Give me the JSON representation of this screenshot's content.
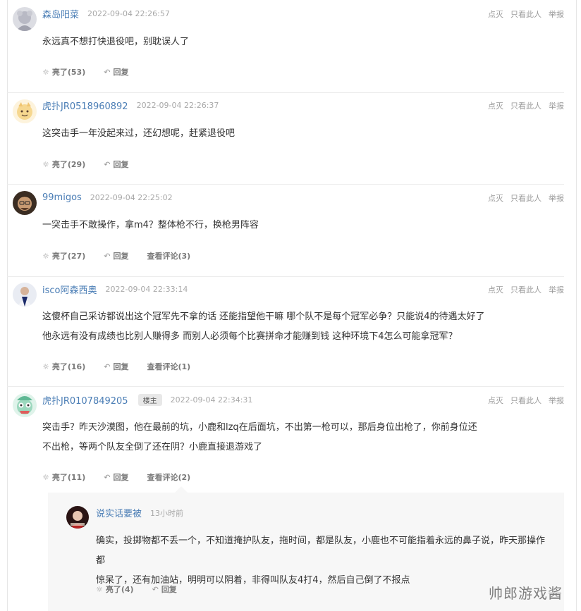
{
  "tools": {
    "dislike": "点灭",
    "only_this": "只看此人",
    "report": "举报"
  },
  "comments": [
    {
      "user": "森岛阳菜",
      "time": "2022-09-04 22:26:57",
      "lines": [
        "永远真不想打快退役吧，别耽误人了"
      ],
      "like": "亮了(53)",
      "reply": "回复",
      "view": ""
    },
    {
      "user": "虎扑JR0518960892",
      "time": "2022-09-04 22:26:37",
      "lines": [
        "这突击手一年没起来过，还幻想呢，赶紧退役吧"
      ],
      "like": "亮了(29)",
      "reply": "回复",
      "view": ""
    },
    {
      "user": "99migos",
      "time": "2022-09-04 22:25:02",
      "lines": [
        "一突击手不敢操作，拿m4？整体枪不行，换枪男阵容"
      ],
      "like": "亮了(27)",
      "reply": "回复",
      "view": "查看评论(3)"
    },
    {
      "user": "isco阿森西奥",
      "time": "2022-09-04 22:33:14",
      "lines": [
        "这傻杯自己采访都说出这个冠军先不拿的话 还能指望他干嘛 哪个队不是每个冠军必争？只能说4的待遇太好了",
        "他永远有没有成绩也比别人赚得多  而别人必须每个比赛拼命才能赚到钱 这种环境下4怎么可能拿冠军？"
      ],
      "like": "亮了(16)",
      "reply": "回复",
      "view": "查看评论(1)"
    },
    {
      "user": "虎扑JR0107849205",
      "badge": "楼主",
      "time": "2022-09-04 22:34:31",
      "lines": [
        "突击手？昨天沙漠图，他在最前的坑，小鹿和lzq在后面坑，不出第一枪可以，那后身位出枪了，你前身位还",
        "不出枪，等两个队友全倒了还在阴？小鹿直接退游戏了"
      ],
      "like": "亮了(11)",
      "reply": "回复",
      "view": "查看评论(2)"
    }
  ],
  "sub_reply": {
    "user": "说实话要被",
    "time": "13小时前",
    "lines": [
      "确实，投掷物都不丢一个，不知道掩护队友，拖时间，都是队友，小鹿也不可能指着永远的鼻子说，昨天那操作都",
      "惊呆了，还有加油站，明明可以阴着，非得叫队友4打4，然后自己倒了不报点"
    ],
    "like": "亮了(4)",
    "reply": "回复"
  },
  "watermark": "帅郎游戏酱",
  "colors": {
    "username": "#4a7db5",
    "time": "#a8a8a8",
    "tools": "#9a9a9a",
    "reply_bg": "#f7f7f7"
  }
}
